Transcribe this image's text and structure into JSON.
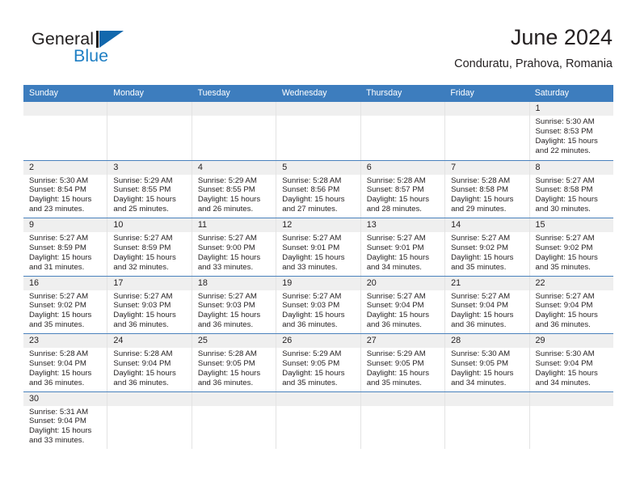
{
  "brand": {
    "word_top": "General",
    "word_bottom": "Blue",
    "accent_color": "#1268ad",
    "text_color": "#221f1f"
  },
  "header": {
    "title": "June 2024",
    "subtitle": "Conduratu, Prahova, Romania"
  },
  "theme": {
    "header_bar_color": "#3d7dbe",
    "row_divider_color": "#4a82bd",
    "day_band_color": "#efefef",
    "column_divider_color": "#e3e3e3",
    "text_color": "#231f20"
  },
  "weekdays": [
    "Sunday",
    "Monday",
    "Tuesday",
    "Wednesday",
    "Thursday",
    "Friday",
    "Saturday"
  ],
  "weeks": [
    [
      {
        "day": "",
        "lines": []
      },
      {
        "day": "",
        "lines": []
      },
      {
        "day": "",
        "lines": []
      },
      {
        "day": "",
        "lines": []
      },
      {
        "day": "",
        "lines": []
      },
      {
        "day": "",
        "lines": []
      },
      {
        "day": "1",
        "lines": [
          "Sunrise: 5:30 AM",
          "Sunset: 8:53 PM",
          "Daylight: 15 hours",
          "and 22 minutes."
        ]
      }
    ],
    [
      {
        "day": "2",
        "lines": [
          "Sunrise: 5:30 AM",
          "Sunset: 8:54 PM",
          "Daylight: 15 hours",
          "and 23 minutes."
        ]
      },
      {
        "day": "3",
        "lines": [
          "Sunrise: 5:29 AM",
          "Sunset: 8:55 PM",
          "Daylight: 15 hours",
          "and 25 minutes."
        ]
      },
      {
        "day": "4",
        "lines": [
          "Sunrise: 5:29 AM",
          "Sunset: 8:55 PM",
          "Daylight: 15 hours",
          "and 26 minutes."
        ]
      },
      {
        "day": "5",
        "lines": [
          "Sunrise: 5:28 AM",
          "Sunset: 8:56 PM",
          "Daylight: 15 hours",
          "and 27 minutes."
        ]
      },
      {
        "day": "6",
        "lines": [
          "Sunrise: 5:28 AM",
          "Sunset: 8:57 PM",
          "Daylight: 15 hours",
          "and 28 minutes."
        ]
      },
      {
        "day": "7",
        "lines": [
          "Sunrise: 5:28 AM",
          "Sunset: 8:58 PM",
          "Daylight: 15 hours",
          "and 29 minutes."
        ]
      },
      {
        "day": "8",
        "lines": [
          "Sunrise: 5:27 AM",
          "Sunset: 8:58 PM",
          "Daylight: 15 hours",
          "and 30 minutes."
        ]
      }
    ],
    [
      {
        "day": "9",
        "lines": [
          "Sunrise: 5:27 AM",
          "Sunset: 8:59 PM",
          "Daylight: 15 hours",
          "and 31 minutes."
        ]
      },
      {
        "day": "10",
        "lines": [
          "Sunrise: 5:27 AM",
          "Sunset: 8:59 PM",
          "Daylight: 15 hours",
          "and 32 minutes."
        ]
      },
      {
        "day": "11",
        "lines": [
          "Sunrise: 5:27 AM",
          "Sunset: 9:00 PM",
          "Daylight: 15 hours",
          "and 33 minutes."
        ]
      },
      {
        "day": "12",
        "lines": [
          "Sunrise: 5:27 AM",
          "Sunset: 9:01 PM",
          "Daylight: 15 hours",
          "and 33 minutes."
        ]
      },
      {
        "day": "13",
        "lines": [
          "Sunrise: 5:27 AM",
          "Sunset: 9:01 PM",
          "Daylight: 15 hours",
          "and 34 minutes."
        ]
      },
      {
        "day": "14",
        "lines": [
          "Sunrise: 5:27 AM",
          "Sunset: 9:02 PM",
          "Daylight: 15 hours",
          "and 35 minutes."
        ]
      },
      {
        "day": "15",
        "lines": [
          "Sunrise: 5:27 AM",
          "Sunset: 9:02 PM",
          "Daylight: 15 hours",
          "and 35 minutes."
        ]
      }
    ],
    [
      {
        "day": "16",
        "lines": [
          "Sunrise: 5:27 AM",
          "Sunset: 9:02 PM",
          "Daylight: 15 hours",
          "and 35 minutes."
        ]
      },
      {
        "day": "17",
        "lines": [
          "Sunrise: 5:27 AM",
          "Sunset: 9:03 PM",
          "Daylight: 15 hours",
          "and 36 minutes."
        ]
      },
      {
        "day": "18",
        "lines": [
          "Sunrise: 5:27 AM",
          "Sunset: 9:03 PM",
          "Daylight: 15 hours",
          "and 36 minutes."
        ]
      },
      {
        "day": "19",
        "lines": [
          "Sunrise: 5:27 AM",
          "Sunset: 9:03 PM",
          "Daylight: 15 hours",
          "and 36 minutes."
        ]
      },
      {
        "day": "20",
        "lines": [
          "Sunrise: 5:27 AM",
          "Sunset: 9:04 PM",
          "Daylight: 15 hours",
          "and 36 minutes."
        ]
      },
      {
        "day": "21",
        "lines": [
          "Sunrise: 5:27 AM",
          "Sunset: 9:04 PM",
          "Daylight: 15 hours",
          "and 36 minutes."
        ]
      },
      {
        "day": "22",
        "lines": [
          "Sunrise: 5:27 AM",
          "Sunset: 9:04 PM",
          "Daylight: 15 hours",
          "and 36 minutes."
        ]
      }
    ],
    [
      {
        "day": "23",
        "lines": [
          "Sunrise: 5:28 AM",
          "Sunset: 9:04 PM",
          "Daylight: 15 hours",
          "and 36 minutes."
        ]
      },
      {
        "day": "24",
        "lines": [
          "Sunrise: 5:28 AM",
          "Sunset: 9:04 PM",
          "Daylight: 15 hours",
          "and 36 minutes."
        ]
      },
      {
        "day": "25",
        "lines": [
          "Sunrise: 5:28 AM",
          "Sunset: 9:05 PM",
          "Daylight: 15 hours",
          "and 36 minutes."
        ]
      },
      {
        "day": "26",
        "lines": [
          "Sunrise: 5:29 AM",
          "Sunset: 9:05 PM",
          "Daylight: 15 hours",
          "and 35 minutes."
        ]
      },
      {
        "day": "27",
        "lines": [
          "Sunrise: 5:29 AM",
          "Sunset: 9:05 PM",
          "Daylight: 15 hours",
          "and 35 minutes."
        ]
      },
      {
        "day": "28",
        "lines": [
          "Sunrise: 5:30 AM",
          "Sunset: 9:05 PM",
          "Daylight: 15 hours",
          "and 34 minutes."
        ]
      },
      {
        "day": "29",
        "lines": [
          "Sunrise: 5:30 AM",
          "Sunset: 9:04 PM",
          "Daylight: 15 hours",
          "and 34 minutes."
        ]
      }
    ],
    [
      {
        "day": "30",
        "lines": [
          "Sunrise: 5:31 AM",
          "Sunset: 9:04 PM",
          "Daylight: 15 hours",
          "and 33 minutes."
        ]
      },
      {
        "day": "",
        "lines": []
      },
      {
        "day": "",
        "lines": []
      },
      {
        "day": "",
        "lines": []
      },
      {
        "day": "",
        "lines": []
      },
      {
        "day": "",
        "lines": []
      },
      {
        "day": "",
        "lines": []
      }
    ]
  ]
}
